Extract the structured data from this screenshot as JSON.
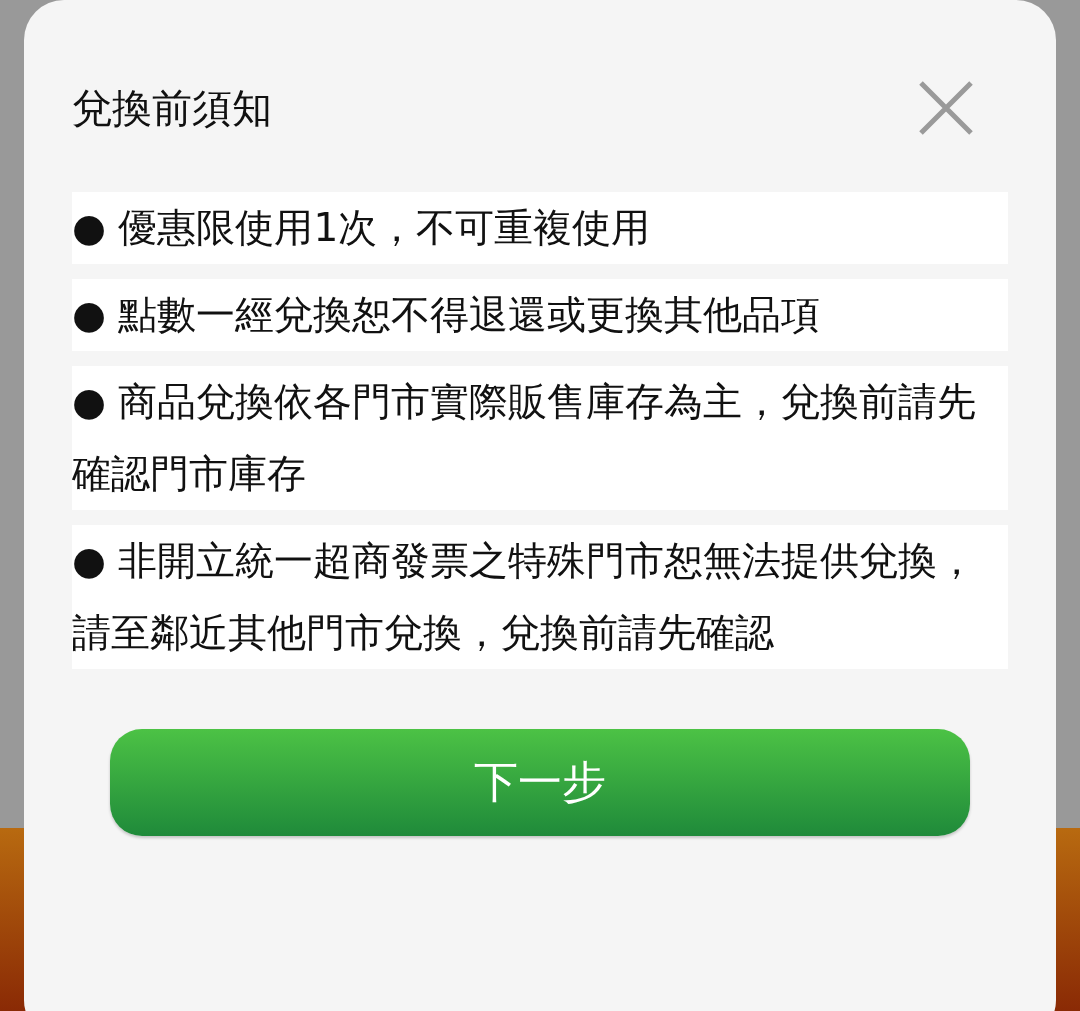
{
  "dialog": {
    "title": "兌換前須知",
    "notices": [
      {
        "text": "● 優惠限使用1次，不可重複使用"
      },
      {
        "text": "● 點數一經兌換恕不得退還或更換其他品項"
      },
      {
        "text": "● 商品兌換依各門市實際販售庫存為主，兌換前請先確認門市庫存"
      },
      {
        "text": "● 非開立統一超商發票之特殊門市恕無法提供兌換，請至鄰近其他門市兌換，兌換前請先確認"
      }
    ],
    "button": "下一步"
  }
}
